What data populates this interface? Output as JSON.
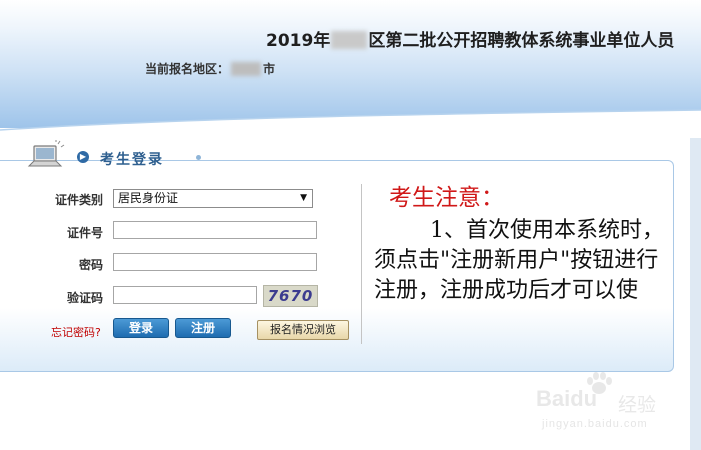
{
  "header": {
    "title_prefix": "2019年",
    "title_suffix": "区第二批公开招聘教体系统事业单位人员",
    "region_label": "当前报名地区：",
    "region_suffix": "市"
  },
  "login": {
    "title": "考生登录",
    "id_type_label": "证件类别",
    "id_type_value": "居民身份证",
    "id_number_label": "证件号",
    "password_label": "密码",
    "captcha_label": "验证码",
    "captcha_text": "7670",
    "forgot_link": "忘记密码?",
    "login_button": "登录",
    "register_button": "注册",
    "browse_button": "报名情况浏览"
  },
  "notice": {
    "title": "考生注意：",
    "body": "1、首次使用本系统时，须点击\"注册新用户\"按钮进行注册，注册成功后才可以使"
  },
  "watermark": {
    "brand": "Baidu",
    "brand_cn": "经验",
    "url": "jingyan.baidu.com"
  }
}
